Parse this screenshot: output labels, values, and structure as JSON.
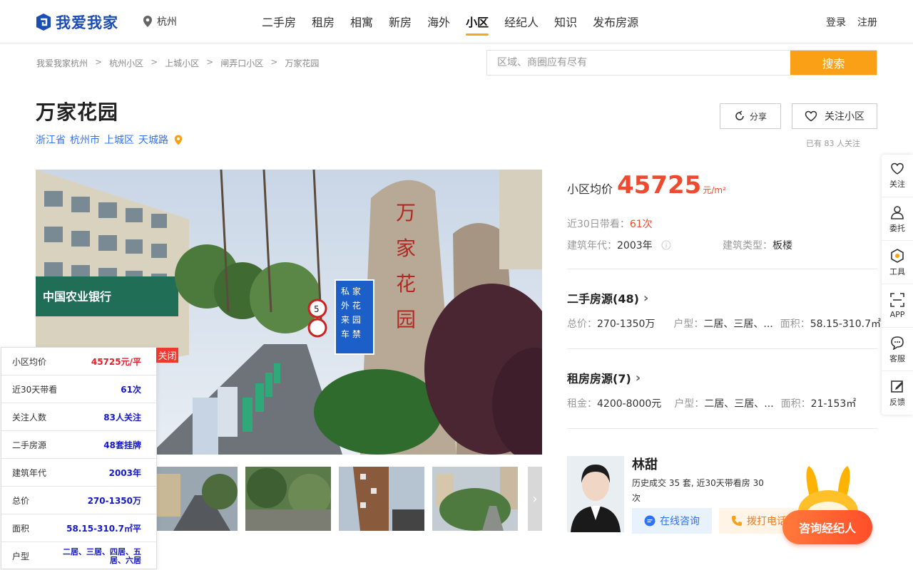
{
  "brand": {
    "name": "我爱我家"
  },
  "header": {
    "city": "杭州",
    "nav": [
      "二手房",
      "租房",
      "相寓",
      "新房",
      "海外",
      "小区",
      "经纪人",
      "知识",
      "发布房源"
    ],
    "active_nav": "小区",
    "login": "登录",
    "register": "注册"
  },
  "breadcrumb": [
    "我爱我家杭州",
    "杭州小区",
    "上城小区",
    "闸弄口小区",
    "万家花园"
  ],
  "search": {
    "placeholder": "区域、商圈应有尽有",
    "button": "搜索"
  },
  "community": {
    "name": "万家花园",
    "address": [
      "浙江省",
      "杭州市",
      "上城区",
      "天城路"
    ],
    "share": "分享",
    "follow": "关注小区",
    "follow_count_text": "已有 83 人关注",
    "avg_label": "小区均价",
    "avg_price": "45725",
    "avg_unit": "元/m²",
    "visits_label": "近30日带看：",
    "visits_value": "61次",
    "year_label": "建筑年代：",
    "year_value": "2003年",
    "type_label": "建筑类型：",
    "type_value": "板楼"
  },
  "second_hand": {
    "title": "二手房源(48)",
    "total_label": "总价：",
    "total_value": "270-1350万",
    "layout_label": "户型：",
    "layout_value": "二居、三居、...",
    "area_label": "面积：",
    "area_value": "58.15-310.7㎡"
  },
  "rental": {
    "title": "租房房源(7)",
    "rent_label": "租金：",
    "rent_value": "4200-8000元",
    "layout_label": "户型：",
    "layout_value": "二居、三居、...",
    "area_label": "面积：",
    "area_value": "21-153㎡"
  },
  "photo": {
    "sign_text": "私家花园 外来车辆禁止入内",
    "bank_text": "中国农业银行",
    "stone_text": "万家花园"
  },
  "agent": {
    "name": "林甜",
    "desc": "历史成交 35 套, 近30天带看房 30 次",
    "consult": "在线咨询",
    "call": "拨打电话"
  },
  "side_toolbar": [
    "关注",
    "委托",
    "工具",
    "APP",
    "客服",
    "反馈"
  ],
  "mascot_button": "咨询经纪人",
  "overlay_panel": {
    "close": "关闭",
    "rows": [
      {
        "k": "小区均价",
        "v": "45725元/平"
      },
      {
        "k": "近30天带看",
        "v": "61次"
      },
      {
        "k": "关注人数",
        "v": "83人关注"
      },
      {
        "k": "二手房源",
        "v": "48套挂牌"
      },
      {
        "k": "建筑年代",
        "v": "2003年"
      },
      {
        "k": "总价",
        "v": "270-1350万"
      },
      {
        "k": "面积",
        "v": "58.15-310.7㎡平"
      },
      {
        "k": "户型",
        "v": "二居、三居、四居、五居、六居"
      }
    ]
  },
  "colors": {
    "brand": "#1a4eb5",
    "accent": "#f9a016",
    "price": "#ee4a2f",
    "link": "#3072f6"
  }
}
